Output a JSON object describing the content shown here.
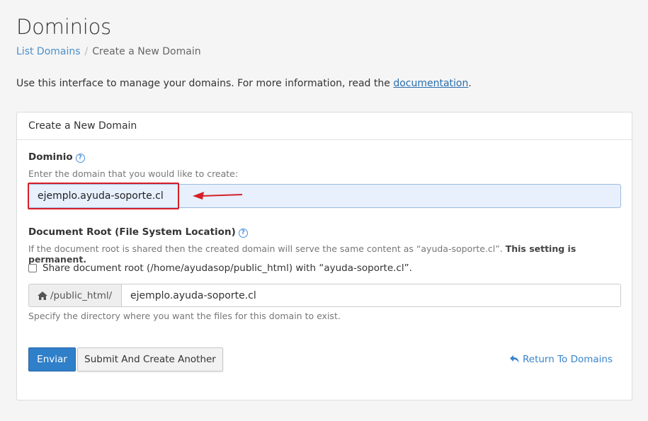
{
  "page": {
    "title": "Dominios",
    "breadcrumb": {
      "link": "List Domains",
      "separator": "/",
      "current": "Create a New Domain"
    },
    "intro": {
      "text": "Use this interface to manage your domains. For more information, read the ",
      "link": "documentation",
      "suffix": "."
    }
  },
  "panel": {
    "heading": "Create a New Domain",
    "domain": {
      "label": "Dominio",
      "hint": "Enter the domain that you would like to create:",
      "value": "ejemplo.ayuda-soporte.cl"
    },
    "docroot": {
      "label": "Document Root (File System Location)",
      "hint_text": "If the document root is shared then the created domain will serve the same content as “ayuda-soporte.cl”. ",
      "hint_bold": "This setting is permanent.",
      "share_label": "Share document root (/home/ayudasop/public_html) with “ayuda-soporte.cl”.",
      "share_checked": false,
      "prefix": "/public_html/",
      "value": "ejemplo.ayuda-soporte.cl",
      "help": "Specify the directory where you want the files for this domain to exist."
    },
    "buttons": {
      "submit": "Enviar",
      "submit_another": "Submit And Create Another",
      "return": "Return To Domains"
    }
  },
  "icons": {
    "help": "question-circle-icon",
    "home": "home-icon",
    "return": "undo-arrow-icon"
  },
  "colors": {
    "primary": "#2f7fc9",
    "link": "#3a84c9",
    "highlight": "#d61f26",
    "input_bg": "#e8f0fe"
  }
}
